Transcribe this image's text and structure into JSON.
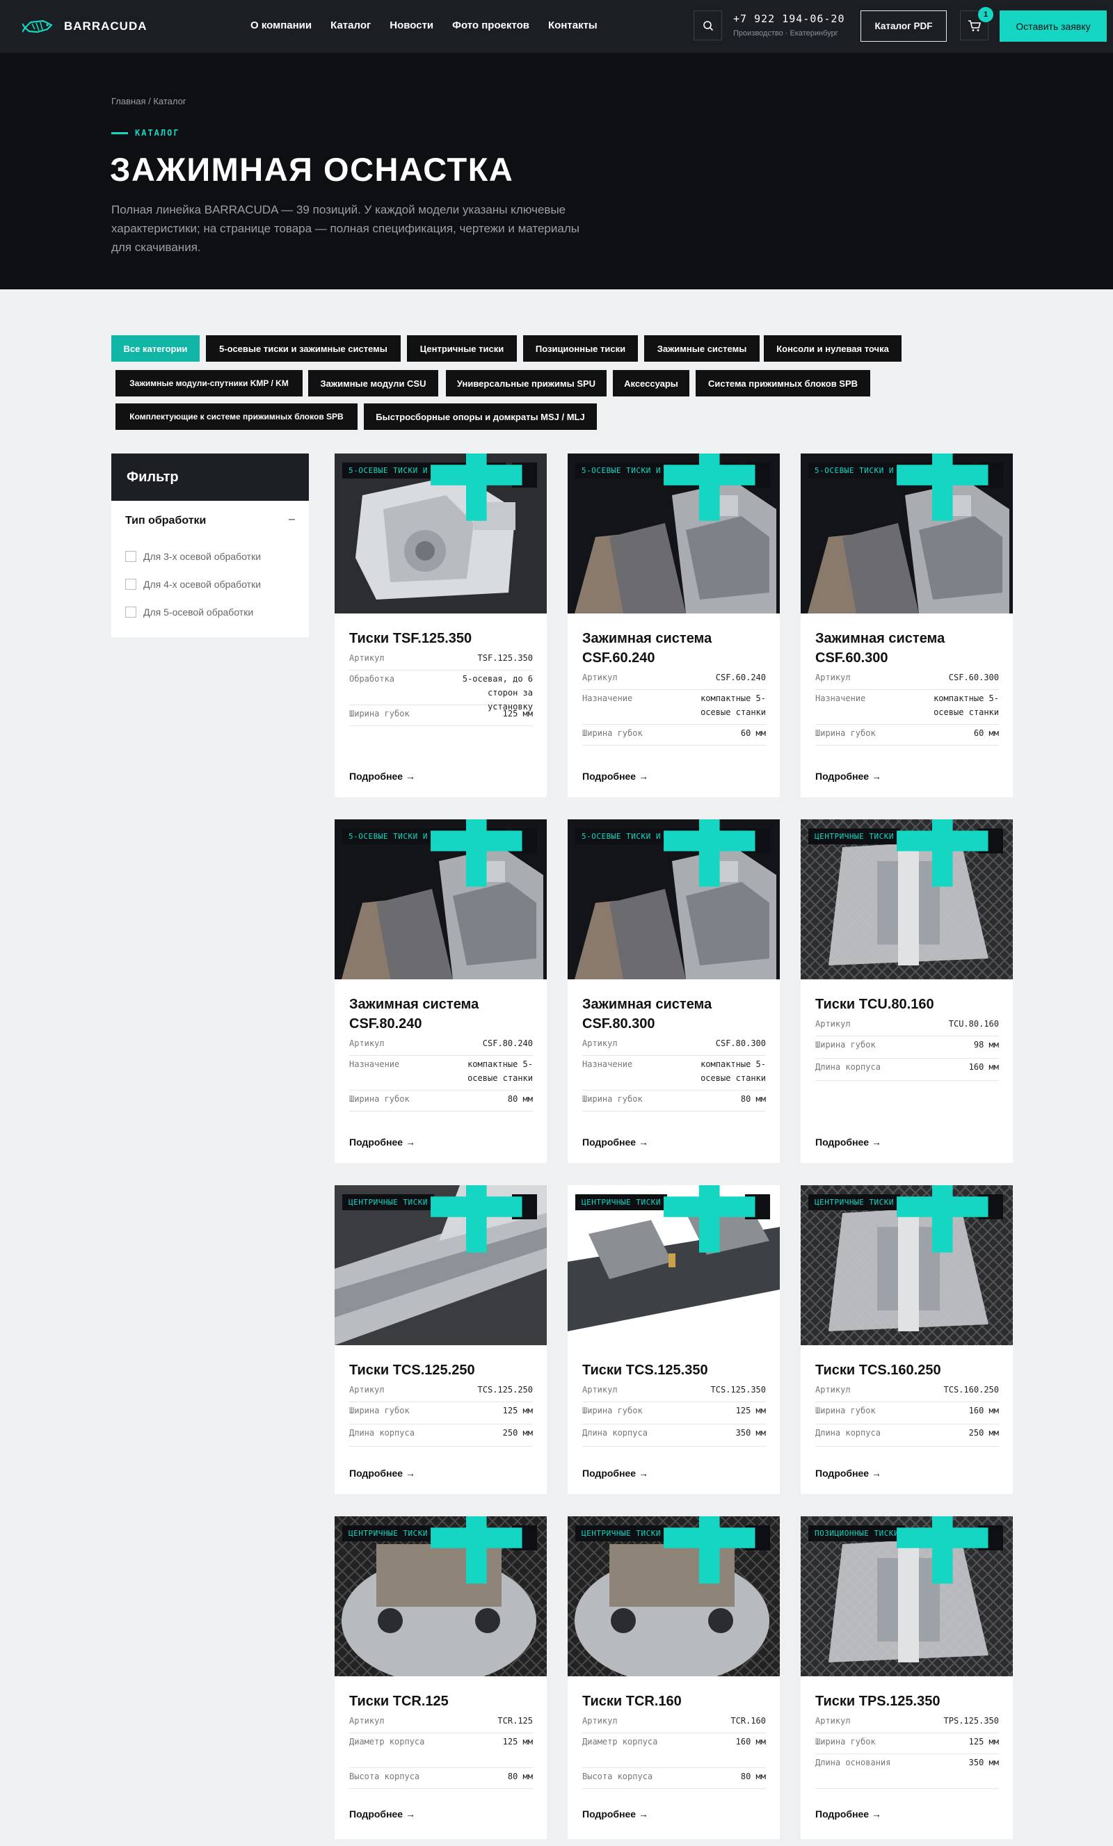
{
  "header": {
    "logo_text": "BARRACUDA",
    "nav": [
      "О компании",
      "Каталог",
      "Новости",
      "Фото проектов",
      "Контакты"
    ],
    "phone": "+7 922 194-06-20",
    "phone_sub": "Производство · Екатеринбург",
    "catalog_pdf_label": "Каталог PDF",
    "cart_count": "1",
    "request_label": "Оставить заявку"
  },
  "hero": {
    "breadcrumb": "Главная / Каталог",
    "eyebrow": "КАТАЛОГ",
    "title": "ЗАЖИМНАЯ ОСНАСТКА",
    "description": "Полная линейка BARRACUDA — 39 позиций. У каждой модели указаны ключевые характеристики; на странице товара — полная спецификация, чертежи и материалы для скачивания."
  },
  "categories": [
    "Все категории",
    "5-осевые тиски и зажимные системы",
    "Центричные тиски",
    "Позиционные тиски",
    "Зажимные системы",
    "Консоли и нулевая точка",
    "Зажимные модули-спутники KMP / KM",
    "Зажимные модули CSU",
    "Универсальные прижимы SPU",
    "Аксессуары",
    "Система прижимных блоков SPB",
    "Комплектующие к системе прижимных блоков SPB",
    "Быстросборные опоры и домкраты MSJ / MLJ"
  ],
  "filter": {
    "title": "Фильтр",
    "group": "Тип обработки",
    "collapse_symbol": "–",
    "options": [
      "Для 3-х осевой обработки",
      "Для 4-х осевой обработки",
      "Для 5-осевой обработки"
    ]
  },
  "card_add_label": "+",
  "more_label": "Подробнее →",
  "products": [
    {
      "tag": "5-ОСЕВЫЕ ТИСКИ И ЗАЖИМНЫЕ СИСТЕМЫ",
      "title": "Тиски TSF.125.350",
      "specs": [
        [
          "Артикул",
          "TSF.125.350"
        ],
        [
          "Обработка",
          "5-осевая, до 6 сторон за установку"
        ],
        [
          "Ширина губок",
          "125 мм"
        ]
      ]
    },
    {
      "tag": "5-ОСЕВЫЕ ТИСКИ И ЗАЖИМНЫЕ СИСТЕМЫ",
      "title": "Зажимная система CSF.60.240",
      "specs": [
        [
          "Артикул",
          "CSF.60.240"
        ],
        [
          "Назначение",
          "компактные 5-осевые станки"
        ],
        [
          "Ширина губок",
          "60 мм"
        ]
      ]
    },
    {
      "tag": "5-ОСЕВЫЕ ТИСКИ И ЗАЖИМНЫЕ СИСТЕМЫ",
      "title": "Зажимная система CSF.60.300",
      "specs": [
        [
          "Артикул",
          "CSF.60.300"
        ],
        [
          "Назначение",
          "компактные 5-осевые станки"
        ],
        [
          "Ширина губок",
          "60 мм"
        ]
      ]
    },
    {
      "tag": "5-ОСЕВЫЕ ТИСКИ И ЗАЖИМНЫЕ СИСТЕМЫ",
      "title": "Зажимная система CSF.80.240",
      "specs": [
        [
          "Артикул",
          "CSF.80.240"
        ],
        [
          "Назначение",
          "компактные 5-осевые станки"
        ],
        [
          "Ширина губок",
          "80 мм"
        ]
      ]
    },
    {
      "tag": "5-ОСЕВЫЕ ТИСКИ И ЗАЖИМНЫЕ СИСТЕМЫ",
      "title": "Зажимная система CSF.80.300",
      "specs": [
        [
          "Артикул",
          "CSF.80.300"
        ],
        [
          "Назначение",
          "компактные 5-осевые станки"
        ],
        [
          "Ширина губок",
          "80 мм"
        ]
      ]
    },
    {
      "tag": "ЦЕНТРИЧНЫЕ ТИСКИ",
      "title": "Тиски TCU.80.160",
      "specs": [
        [
          "Артикул",
          "TCU.80.160"
        ],
        [
          "Ширина губок",
          "98 мм"
        ],
        [
          "Длина корпуса",
          "160 мм"
        ]
      ]
    },
    {
      "tag": "ЦЕНТРИЧНЫЕ ТИСКИ",
      "title": "Тиски TCS.125.250",
      "specs": [
        [
          "Артикул",
          "TCS.125.250"
        ],
        [
          "Ширина губок",
          "125 мм"
        ],
        [
          "Длина корпуса",
          "250 мм"
        ]
      ]
    },
    {
      "tag": "ЦЕНТРИЧНЫЕ ТИСКИ",
      "title": "Тиски TCS.125.350",
      "specs": [
        [
          "Артикул",
          "TCS.125.350"
        ],
        [
          "Ширина губок",
          "125 мм"
        ],
        [
          "Длина корпуса",
          "350 мм"
        ]
      ]
    },
    {
      "tag": "ЦЕНТРИЧНЫЕ ТИСКИ",
      "title": "Тиски TCS.160.250",
      "specs": [
        [
          "Артикул",
          "TCS.160.250"
        ],
        [
          "Ширина губок",
          "160 мм"
        ],
        [
          "Длина корпуса",
          "250 мм"
        ]
      ]
    },
    {
      "tag": "ЦЕНТРИЧНЫЕ ТИСКИ",
      "title": "Тиски TCR.125",
      "specs": [
        [
          "Артикул",
          "TCR.125"
        ],
        [
          "Диаметр корпуса",
          "125 мм"
        ],
        [
          "Высота корпуса",
          "80 мм"
        ]
      ]
    },
    {
      "tag": "ЦЕНТРИЧНЫЕ ТИСКИ",
      "title": "Тиски TCR.160",
      "specs": [
        [
          "Артикул",
          "TCR.160"
        ],
        [
          "Диаметр корпуса",
          "160 мм"
        ],
        [
          "Высота корпуса",
          "80 мм"
        ]
      ]
    },
    {
      "tag": "ПОЗИЦИОННЫЕ ТИСКИ",
      "title": "Тиски TPS.125.350",
      "specs": [
        [
          "Артикул",
          "TPS.125.350"
        ],
        [
          "Ширина губок",
          "125 мм"
        ],
        [
          "Длина основания",
          "350 мм"
        ]
      ]
    }
  ],
  "colors": {
    "accent": "#14d6c2",
    "dark": "#0d0f13",
    "header": "#1b1e23",
    "page": "#eef0f2"
  }
}
